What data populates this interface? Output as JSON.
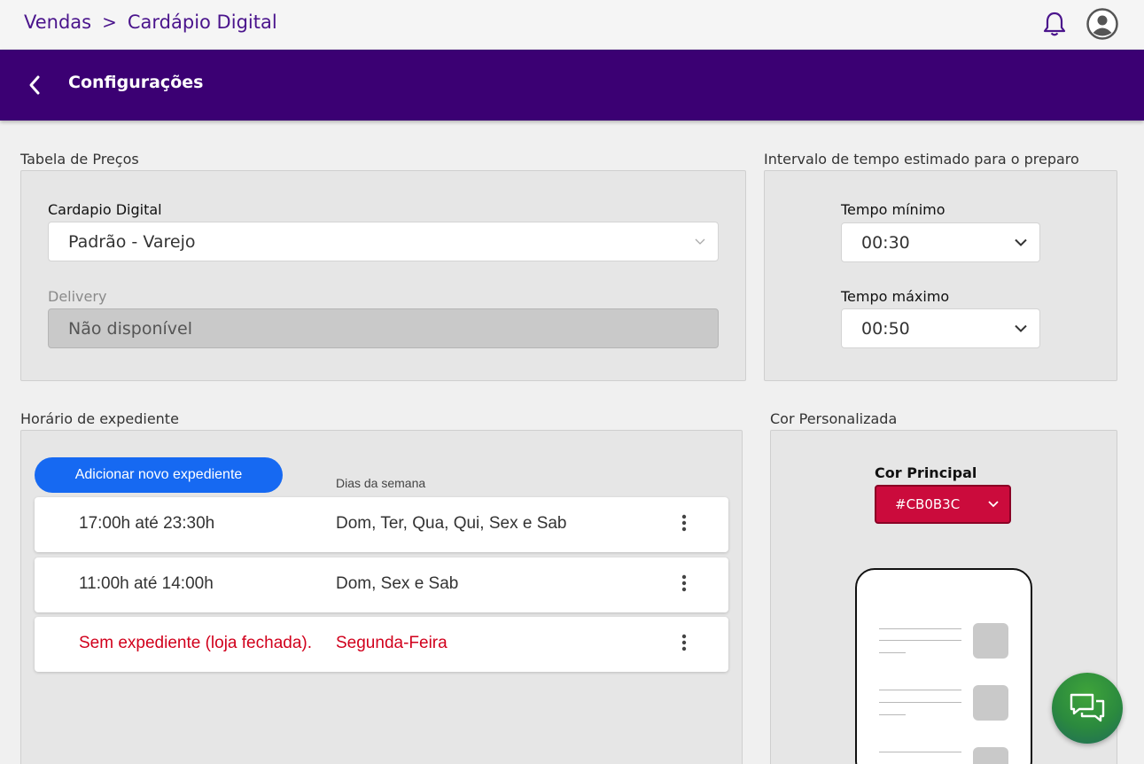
{
  "breadcrumb": {
    "root": "Vendas",
    "separator": ">",
    "current": "Cardápio Digital"
  },
  "header": {
    "title": "Configurações"
  },
  "price_table": {
    "section_label": "Tabela de Preços",
    "digital_menu_label": "Cardapio Digital",
    "digital_menu_value": "Padrão - Varejo",
    "delivery_label": "Delivery",
    "delivery_value": "Não disponível"
  },
  "prep_time": {
    "section_label": "Intervalo de tempo estimado para o preparo",
    "min_label": "Tempo mínimo",
    "min_value": "00:30",
    "max_label": "Tempo máximo",
    "max_value": "00:50"
  },
  "business_hours": {
    "section_label": "Horário de expediente",
    "add_button": "Adicionar novo expediente",
    "days_header": "Dias da semana",
    "rows": [
      {
        "time": "17:00h até 23:30h",
        "days": "Dom, Ter, Qua, Qui, Sex e Sab"
      },
      {
        "time": "11:00h até 14:00h",
        "days": "Dom, Sex e Sab"
      },
      {
        "time": "Sem expediente (loja fechada).",
        "days": "Segunda-Feira"
      }
    ]
  },
  "custom_color": {
    "section_label": "Cor Personalizada",
    "main_color_label": "Cor Principal",
    "main_color_value": "#CB0B3C"
  },
  "colors": {
    "brand_purple": "#3b0073",
    "primary_blue": "#1669f2",
    "closed_red": "#d1001c",
    "custom_color": "#cb0b3c"
  },
  "icons": [
    "bell-icon",
    "user-avatar-icon",
    "back-arrow-icon",
    "chevron-down-icon",
    "kebab-menu-icon",
    "chat-icon"
  ]
}
